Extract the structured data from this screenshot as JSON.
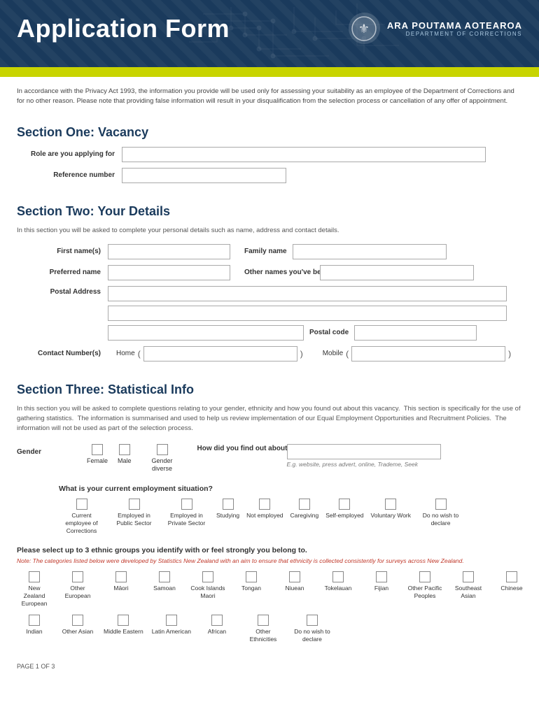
{
  "header": {
    "title": "Application Form",
    "logo_main": "ARA POUTAMA AOTEAROA",
    "logo_sub": "DEPARTMENT OF CORRECTIONS",
    "emblem": "🏛"
  },
  "privacy": {
    "text": "In accordance with the Privacy Act 1993, the information you provide will be used only for assessing your suitability as an employee of the Department of Corrections and for no other reason. Please note that providing false information will result in your disqualification from the selection process or cancellation of any offer of appointment."
  },
  "sections": {
    "one": {
      "title": "Section One: Vacancy",
      "role_label": "Role are you applying for",
      "reference_label": "Reference number"
    },
    "two": {
      "title": "Section Two: Your Details",
      "desc": "In this section you will be asked to complete your personal details such as name, address and contact details.",
      "first_name_label": "First name(s)",
      "family_name_label": "Family name",
      "preferred_name_label": "Preferred name",
      "other_names_label": "Other names you've been known as",
      "postal_address_label": "Postal Address",
      "postal_code_label": "Postal code",
      "contact_numbers_label": "Contact Number(s)",
      "home_label": "Home",
      "mobile_label": "Mobile"
    },
    "three": {
      "title": "Section Three: Statistical Info",
      "desc1": "In this section you will be asked to complete questions relating to your gender, ethnicity and how you found out about this vacancy.",
      "desc2": "This section is specifically for the use of gathering statistics.",
      "desc3": "The information is summarised and used to help us review implementation of our Equal Employment Opportunities and Recruitment Policies.",
      "desc4": "The information will not be used as part of the selection process.",
      "gender_label": "Gender",
      "gender_options": [
        {
          "id": "female",
          "label": "Female"
        },
        {
          "id": "male",
          "label": "Male"
        },
        {
          "id": "gender-diverse",
          "label": "Gender diverse"
        }
      ],
      "how_found_label": "How did you find out about working for Corrections?",
      "how_found_hint": "E.g. website, press advert, online, Trademe, Seek",
      "employment_question": "What is your current employment situation?",
      "employment_options": [
        {
          "id": "current-corrections",
          "label": "Current employee of Corrections"
        },
        {
          "id": "employed-public",
          "label": "Employed in Public Sector"
        },
        {
          "id": "employed-private",
          "label": "Employed in Private Sector"
        },
        {
          "id": "studying",
          "label": "Studying"
        },
        {
          "id": "not-employed",
          "label": "Not employed"
        },
        {
          "id": "caregiving",
          "label": "Caregiving"
        },
        {
          "id": "self-employed",
          "label": "Self-employed"
        },
        {
          "id": "voluntary-work",
          "label": "Voluntary Work"
        },
        {
          "id": "do-not-wish",
          "label": "Do no wish to declare"
        }
      ],
      "ethnicity_title": "Please select up to 3 ethnic groups you identify with or feel strongly you belong to.",
      "ethnicity_note": "Note: The categories listed below were developed by Statistics New Zealand with an aim to ensure that ethnicity is collected consistently for surveys across New Zealand.",
      "ethnicity_row1": [
        {
          "id": "nz-european",
          "label": "New Zealand European"
        },
        {
          "id": "other-european",
          "label": "Other European"
        },
        {
          "id": "maori",
          "label": "Māori"
        },
        {
          "id": "samoan",
          "label": "Samoan"
        },
        {
          "id": "cook-islands-maori",
          "label": "Cook Islands Maori"
        },
        {
          "id": "tongan",
          "label": "Tongan"
        },
        {
          "id": "niuean",
          "label": "Niuean"
        },
        {
          "id": "tokelauan",
          "label": "Tokelauan"
        },
        {
          "id": "fijian",
          "label": "Fijian"
        },
        {
          "id": "other-pacific",
          "label": "Other Pacific Peoples"
        },
        {
          "id": "southeast-asian",
          "label": "Southeast Asian"
        },
        {
          "id": "chinese",
          "label": "Chinese"
        }
      ],
      "ethnicity_row2": [
        {
          "id": "indian",
          "label": "Indian"
        },
        {
          "id": "other-asian",
          "label": "Other Asian"
        },
        {
          "id": "middle-eastern",
          "label": "Middle Eastern"
        },
        {
          "id": "latin-american",
          "label": "Latin American"
        },
        {
          "id": "african",
          "label": "African"
        },
        {
          "id": "other-ethnicities",
          "label": "Other Ethnicities"
        },
        {
          "id": "do-not-wish-eth",
          "label": "Do no wish to declare"
        }
      ]
    }
  },
  "footer": {
    "page_info": "PAGE 1 OF 3"
  }
}
